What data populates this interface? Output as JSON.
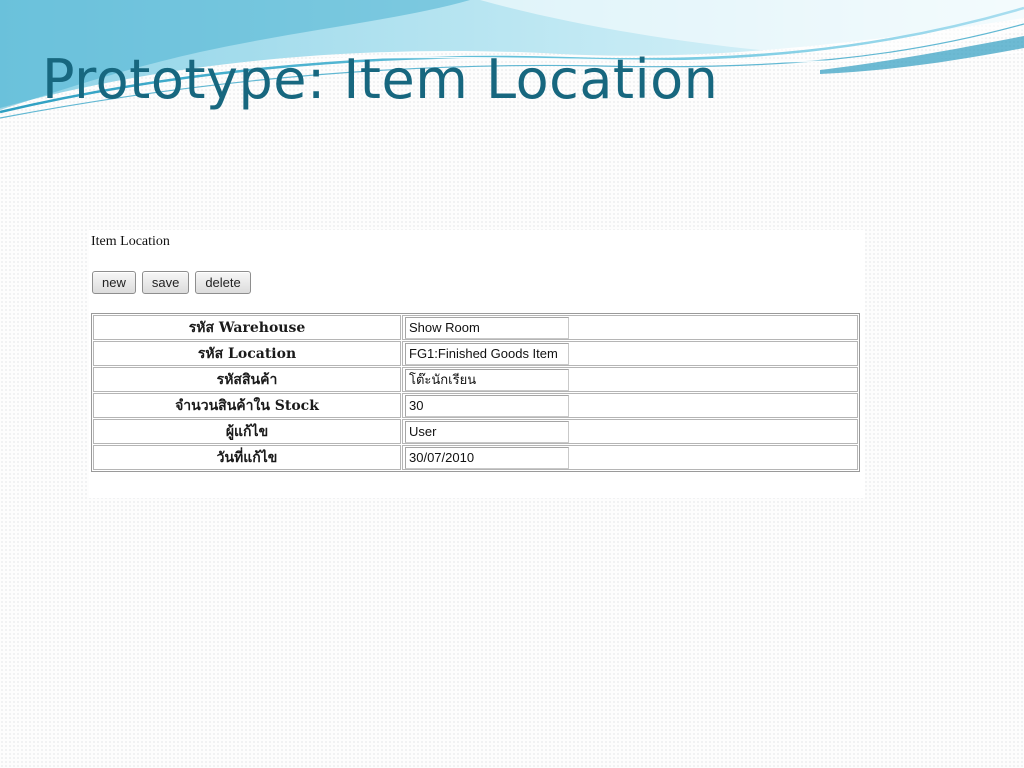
{
  "slide": {
    "title": "Prototype: Item Location"
  },
  "form": {
    "title": "Item Location",
    "buttons": {
      "new_label": "new",
      "save_label": "save",
      "delete_label": "delete"
    },
    "fields": [
      {
        "label": "รหัส Warehouse",
        "value": "Show Room"
      },
      {
        "label": "รหัส Location",
        "value": "FG1:Finished Goods Item"
      },
      {
        "label": "รหัสสินค้า",
        "value": "โต๊ะนักเรียน"
      },
      {
        "label": "จำนวนสินค้าใน Stock",
        "value": "30"
      },
      {
        "label": "ผู้แก้ไข",
        "value": "User"
      },
      {
        "label": "วันที่แก้ไข",
        "value": "30/07/2010"
      }
    ]
  },
  "colors": {
    "title_teal": "#17677f",
    "wave_light": "#bfe6f2",
    "wave_mid": "#6cc3dc",
    "wave_dark": "#1f8fb1"
  }
}
